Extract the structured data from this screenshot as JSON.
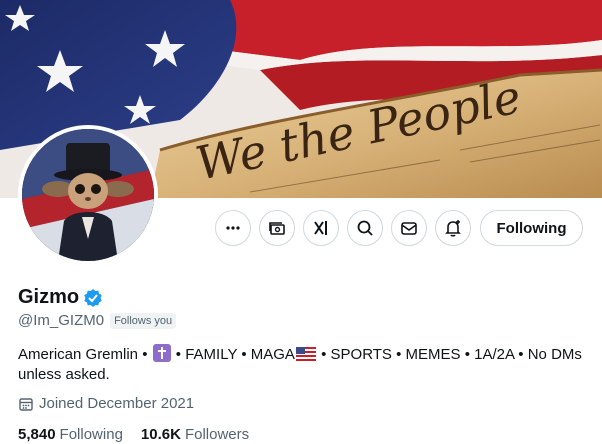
{
  "profile": {
    "display_name": "Gizmo",
    "handle": "@Im_GIZM0",
    "follows_you": "Follows you",
    "verified_color": "#1d9bf0"
  },
  "bio": {
    "part1": "American Gremlin • ",
    "part2": " • FAMILY • MAGA",
    "part3": " • SPORTS • MEMES • 1A/2A • No DMs unless asked."
  },
  "joined": "Joined December 2021",
  "stats": {
    "following_count": "5,840",
    "following_label": "Following",
    "followers_count": "10.6K",
    "followers_label": "Followers"
  },
  "actions": {
    "following_button": "Following"
  },
  "banner": {
    "parchment_text": "We the People"
  },
  "icons": [
    "more-icon",
    "subscription-icon",
    "grok-icon",
    "search-icon",
    "message-icon",
    "notify-icon",
    "calendar-icon",
    "verified-badge-icon",
    "cross-emoji-icon",
    "us-flag-emoji-icon"
  ]
}
